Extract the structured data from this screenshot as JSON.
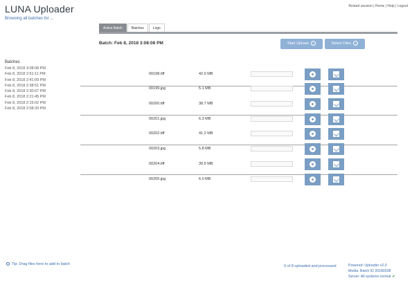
{
  "app": {
    "title": "LUNA Uploader",
    "subtitle": "Browsing all batches for ...",
    "top_links": "Restart session | Home | Help | Logout"
  },
  "tabs": [
    {
      "label": "Active Batch",
      "active": true
    },
    {
      "label": "Batches",
      "active": false
    },
    {
      "label": "Logs",
      "active": false
    }
  ],
  "batch": {
    "label": "Batch: Feb 8, 2018 3:08:08 PM"
  },
  "buttons": {
    "start_upload": "Start Upload",
    "select_files": "Select Files"
  },
  "sidebar": {
    "header": "Batches",
    "items": [
      "Feb 8, 2018 3:08:08 PM",
      "Feb 8, 2018 2:51:11 PM",
      "Feb 8, 2018 2:41:09 PM",
      "Feb 8, 2018 2:38:51 PM",
      "Feb 8, 2018 2:30:07 PM",
      "Feb 8, 2018 2:21:45 PM",
      "Feb 8, 2018 2:15:02 PM",
      "Feb 8, 2018 2:08:33 PM"
    ]
  },
  "files": [
    {
      "name": "00198.tiff",
      "size": "42.0 MB"
    },
    {
      "name": "00199.jpg",
      "size": "5.1 MB"
    },
    {
      "name": "00200.tiff",
      "size": "38.7 MB"
    },
    {
      "name": "00201.jpg",
      "size": "6.3 MB"
    },
    {
      "name": "00202.tiff",
      "size": "41.2 MB"
    },
    {
      "name": "00203.jpg",
      "size": "5.8 MB"
    },
    {
      "name": "00204.tiff",
      "size": "39.5 MB"
    },
    {
      "name": "00205.jpg",
      "size": "6.0 MB"
    }
  ],
  "footer": {
    "left": "Tip: Drag files here to add to batch",
    "middle": "0 of 8 uploaded and processed",
    "right_line1": "Powered: Uploader v2.0",
    "right_line2": "Media: Batch ID 20180208",
    "right_line3": "Server: All systems normal"
  }
}
